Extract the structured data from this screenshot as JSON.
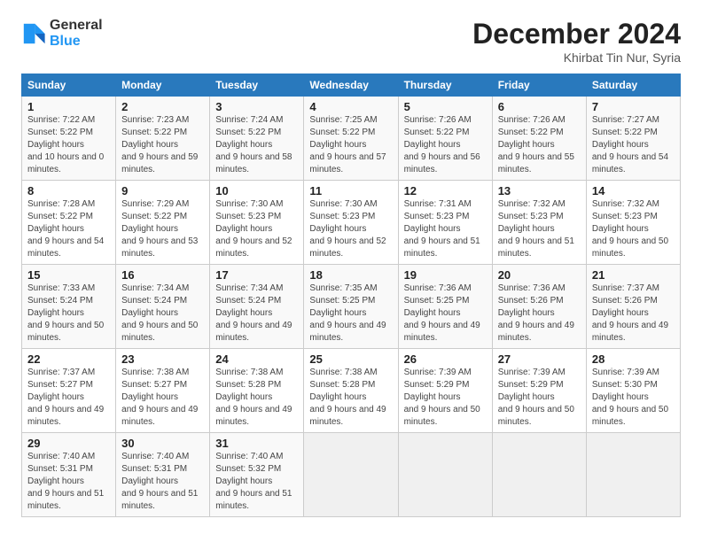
{
  "header": {
    "logo_line1": "General",
    "logo_line2": "Blue",
    "title": "December 2024",
    "location": "Khirbat Tin Nur, Syria"
  },
  "days_of_week": [
    "Sunday",
    "Monday",
    "Tuesday",
    "Wednesday",
    "Thursday",
    "Friday",
    "Saturday"
  ],
  "weeks": [
    [
      {
        "day": 1,
        "sunrise": "7:22 AM",
        "sunset": "5:22 PM",
        "daylight": "10 hours and 0 minutes."
      },
      {
        "day": 2,
        "sunrise": "7:23 AM",
        "sunset": "5:22 PM",
        "daylight": "9 hours and 59 minutes."
      },
      {
        "day": 3,
        "sunrise": "7:24 AM",
        "sunset": "5:22 PM",
        "daylight": "9 hours and 58 minutes."
      },
      {
        "day": 4,
        "sunrise": "7:25 AM",
        "sunset": "5:22 PM",
        "daylight": "9 hours and 57 minutes."
      },
      {
        "day": 5,
        "sunrise": "7:26 AM",
        "sunset": "5:22 PM",
        "daylight": "9 hours and 56 minutes."
      },
      {
        "day": 6,
        "sunrise": "7:26 AM",
        "sunset": "5:22 PM",
        "daylight": "9 hours and 55 minutes."
      },
      {
        "day": 7,
        "sunrise": "7:27 AM",
        "sunset": "5:22 PM",
        "daylight": "9 hours and 54 minutes."
      }
    ],
    [
      {
        "day": 8,
        "sunrise": "7:28 AM",
        "sunset": "5:22 PM",
        "daylight": "9 hours and 54 minutes."
      },
      {
        "day": 9,
        "sunrise": "7:29 AM",
        "sunset": "5:22 PM",
        "daylight": "9 hours and 53 minutes."
      },
      {
        "day": 10,
        "sunrise": "7:30 AM",
        "sunset": "5:23 PM",
        "daylight": "9 hours and 52 minutes."
      },
      {
        "day": 11,
        "sunrise": "7:30 AM",
        "sunset": "5:23 PM",
        "daylight": "9 hours and 52 minutes."
      },
      {
        "day": 12,
        "sunrise": "7:31 AM",
        "sunset": "5:23 PM",
        "daylight": "9 hours and 51 minutes."
      },
      {
        "day": 13,
        "sunrise": "7:32 AM",
        "sunset": "5:23 PM",
        "daylight": "9 hours and 51 minutes."
      },
      {
        "day": 14,
        "sunrise": "7:32 AM",
        "sunset": "5:23 PM",
        "daylight": "9 hours and 50 minutes."
      }
    ],
    [
      {
        "day": 15,
        "sunrise": "7:33 AM",
        "sunset": "5:24 PM",
        "daylight": "9 hours and 50 minutes."
      },
      {
        "day": 16,
        "sunrise": "7:34 AM",
        "sunset": "5:24 PM",
        "daylight": "9 hours and 50 minutes."
      },
      {
        "day": 17,
        "sunrise": "7:34 AM",
        "sunset": "5:24 PM",
        "daylight": "9 hours and 49 minutes."
      },
      {
        "day": 18,
        "sunrise": "7:35 AM",
        "sunset": "5:25 PM",
        "daylight": "9 hours and 49 minutes."
      },
      {
        "day": 19,
        "sunrise": "7:36 AM",
        "sunset": "5:25 PM",
        "daylight": "9 hours and 49 minutes."
      },
      {
        "day": 20,
        "sunrise": "7:36 AM",
        "sunset": "5:26 PM",
        "daylight": "9 hours and 49 minutes."
      },
      {
        "day": 21,
        "sunrise": "7:37 AM",
        "sunset": "5:26 PM",
        "daylight": "9 hours and 49 minutes."
      }
    ],
    [
      {
        "day": 22,
        "sunrise": "7:37 AM",
        "sunset": "5:27 PM",
        "daylight": "9 hours and 49 minutes."
      },
      {
        "day": 23,
        "sunrise": "7:38 AM",
        "sunset": "5:27 PM",
        "daylight": "9 hours and 49 minutes."
      },
      {
        "day": 24,
        "sunrise": "7:38 AM",
        "sunset": "5:28 PM",
        "daylight": "9 hours and 49 minutes."
      },
      {
        "day": 25,
        "sunrise": "7:38 AM",
        "sunset": "5:28 PM",
        "daylight": "9 hours and 49 minutes."
      },
      {
        "day": 26,
        "sunrise": "7:39 AM",
        "sunset": "5:29 PM",
        "daylight": "9 hours and 50 minutes."
      },
      {
        "day": 27,
        "sunrise": "7:39 AM",
        "sunset": "5:29 PM",
        "daylight": "9 hours and 50 minutes."
      },
      {
        "day": 28,
        "sunrise": "7:39 AM",
        "sunset": "5:30 PM",
        "daylight": "9 hours and 50 minutes."
      }
    ],
    [
      {
        "day": 29,
        "sunrise": "7:40 AM",
        "sunset": "5:31 PM",
        "daylight": "9 hours and 51 minutes."
      },
      {
        "day": 30,
        "sunrise": "7:40 AM",
        "sunset": "5:31 PM",
        "daylight": "9 hours and 51 minutes."
      },
      {
        "day": 31,
        "sunrise": "7:40 AM",
        "sunset": "5:32 PM",
        "daylight": "9 hours and 51 minutes."
      },
      null,
      null,
      null,
      null
    ]
  ]
}
